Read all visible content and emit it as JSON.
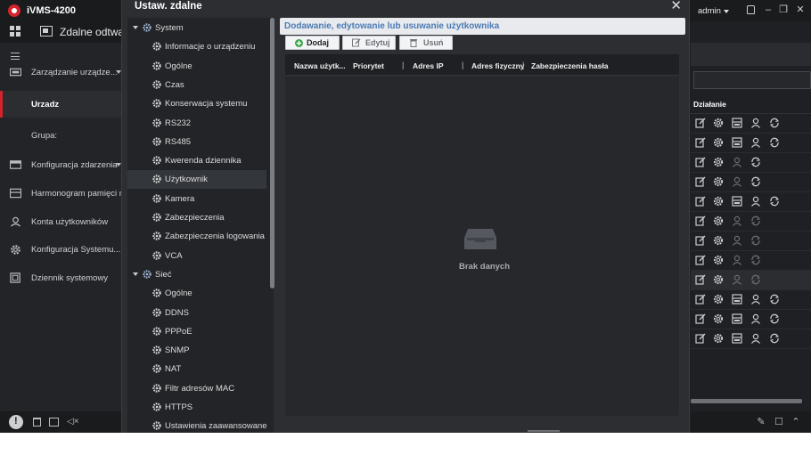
{
  "app": {
    "title": "iVMS-4200",
    "tab_label": "Zdalne odtwarza"
  },
  "header": {
    "user": "admin"
  },
  "left_nav": {
    "items": [
      {
        "label": "Zarządzanie urządze...",
        "icon": "device-manage-icon",
        "has_caret": true
      },
      {
        "label": "Urzadz",
        "active": true
      },
      {
        "label": "Grupa:"
      },
      {
        "label": "Konfiguracja zdarzenia",
        "icon": "event-config-icon",
        "has_caret": true
      },
      {
        "label": "Harmonogram pamięci m",
        "icon": "storage-schedule-icon"
      },
      {
        "label": "Konta użytkowników",
        "icon": "user-accounts-icon"
      },
      {
        "label": "Konfiguracja Systemu...",
        "icon": "system-config-icon"
      },
      {
        "label": "Dziennik systemowy",
        "icon": "system-log-icon"
      }
    ]
  },
  "dialog": {
    "title": "Ustaw. zdalne",
    "tree": [
      {
        "label": "System",
        "level": 0
      },
      {
        "label": "Informacje o urządzeniu",
        "level": 1
      },
      {
        "label": "Ogólne",
        "level": 1
      },
      {
        "label": "Czas",
        "level": 1
      },
      {
        "label": "Konserwacja systemu",
        "level": 1
      },
      {
        "label": "RS232",
        "level": 1
      },
      {
        "label": "RS485",
        "level": 1
      },
      {
        "label": "Kwerenda dziennika",
        "level": 1
      },
      {
        "label": "Użytkownik",
        "level": 1,
        "selected": true
      },
      {
        "label": "Kamera",
        "level": 1
      },
      {
        "label": "Zabezpieczenia",
        "level": 1
      },
      {
        "label": "Zabezpieczenia logowania",
        "level": 1
      },
      {
        "label": "VCA",
        "level": 1
      },
      {
        "label": "Sieć",
        "level": 0
      },
      {
        "label": "Ogólne",
        "level": 1
      },
      {
        "label": "DDNS",
        "level": 1
      },
      {
        "label": "PPPoE",
        "level": 1
      },
      {
        "label": "SNMP",
        "level": 1
      },
      {
        "label": "NAT",
        "level": 1
      },
      {
        "label": "Filtr adresów MAC",
        "level": 1
      },
      {
        "label": "HTTPS",
        "level": 1
      },
      {
        "label": "Ustawienia zaawansowane",
        "level": 1
      }
    ],
    "content_title": "Dodawanie, edytowanie lub usuwanie użytkownika",
    "buttons": {
      "add": "Dodaj",
      "edit": "Edytuj",
      "delete": "Usuń"
    },
    "table": {
      "columns": [
        "Nazwa użytk...",
        "Priorytet",
        "Adres IP",
        "Adres fizyczny",
        "Zabezpieczenia hasła"
      ],
      "empty_text": "Brak danych"
    }
  },
  "right_panel": {
    "header": "Działanie",
    "rows": [
      {
        "user_enabled": true,
        "refresh_enabled": true,
        "storage": true
      },
      {
        "user_enabled": true,
        "refresh_enabled": true,
        "storage": true
      },
      {
        "user_enabled": false,
        "refresh_enabled": true,
        "storage": false
      },
      {
        "user_enabled": false,
        "refresh_enabled": true,
        "storage": false
      },
      {
        "user_enabled": true,
        "refresh_enabled": true,
        "storage": true
      },
      {
        "user_enabled": false,
        "refresh_enabled": false,
        "storage": false
      },
      {
        "user_enabled": false,
        "refresh_enabled": false,
        "storage": false
      },
      {
        "user_enabled": false,
        "refresh_enabled": false,
        "storage": false
      },
      {
        "user_enabled": false,
        "refresh_enabled": false,
        "storage": false,
        "selected": true
      },
      {
        "user_enabled": true,
        "refresh_enabled": true,
        "storage": true
      },
      {
        "user_enabled": true,
        "refresh_enabled": true,
        "storage": true
      },
      {
        "user_enabled": true,
        "refresh_enabled": true,
        "storage": true
      }
    ]
  },
  "colors": {
    "accent": "#d3232d",
    "title_link": "#4b7ab3",
    "add_icon": "#3aa34a"
  }
}
